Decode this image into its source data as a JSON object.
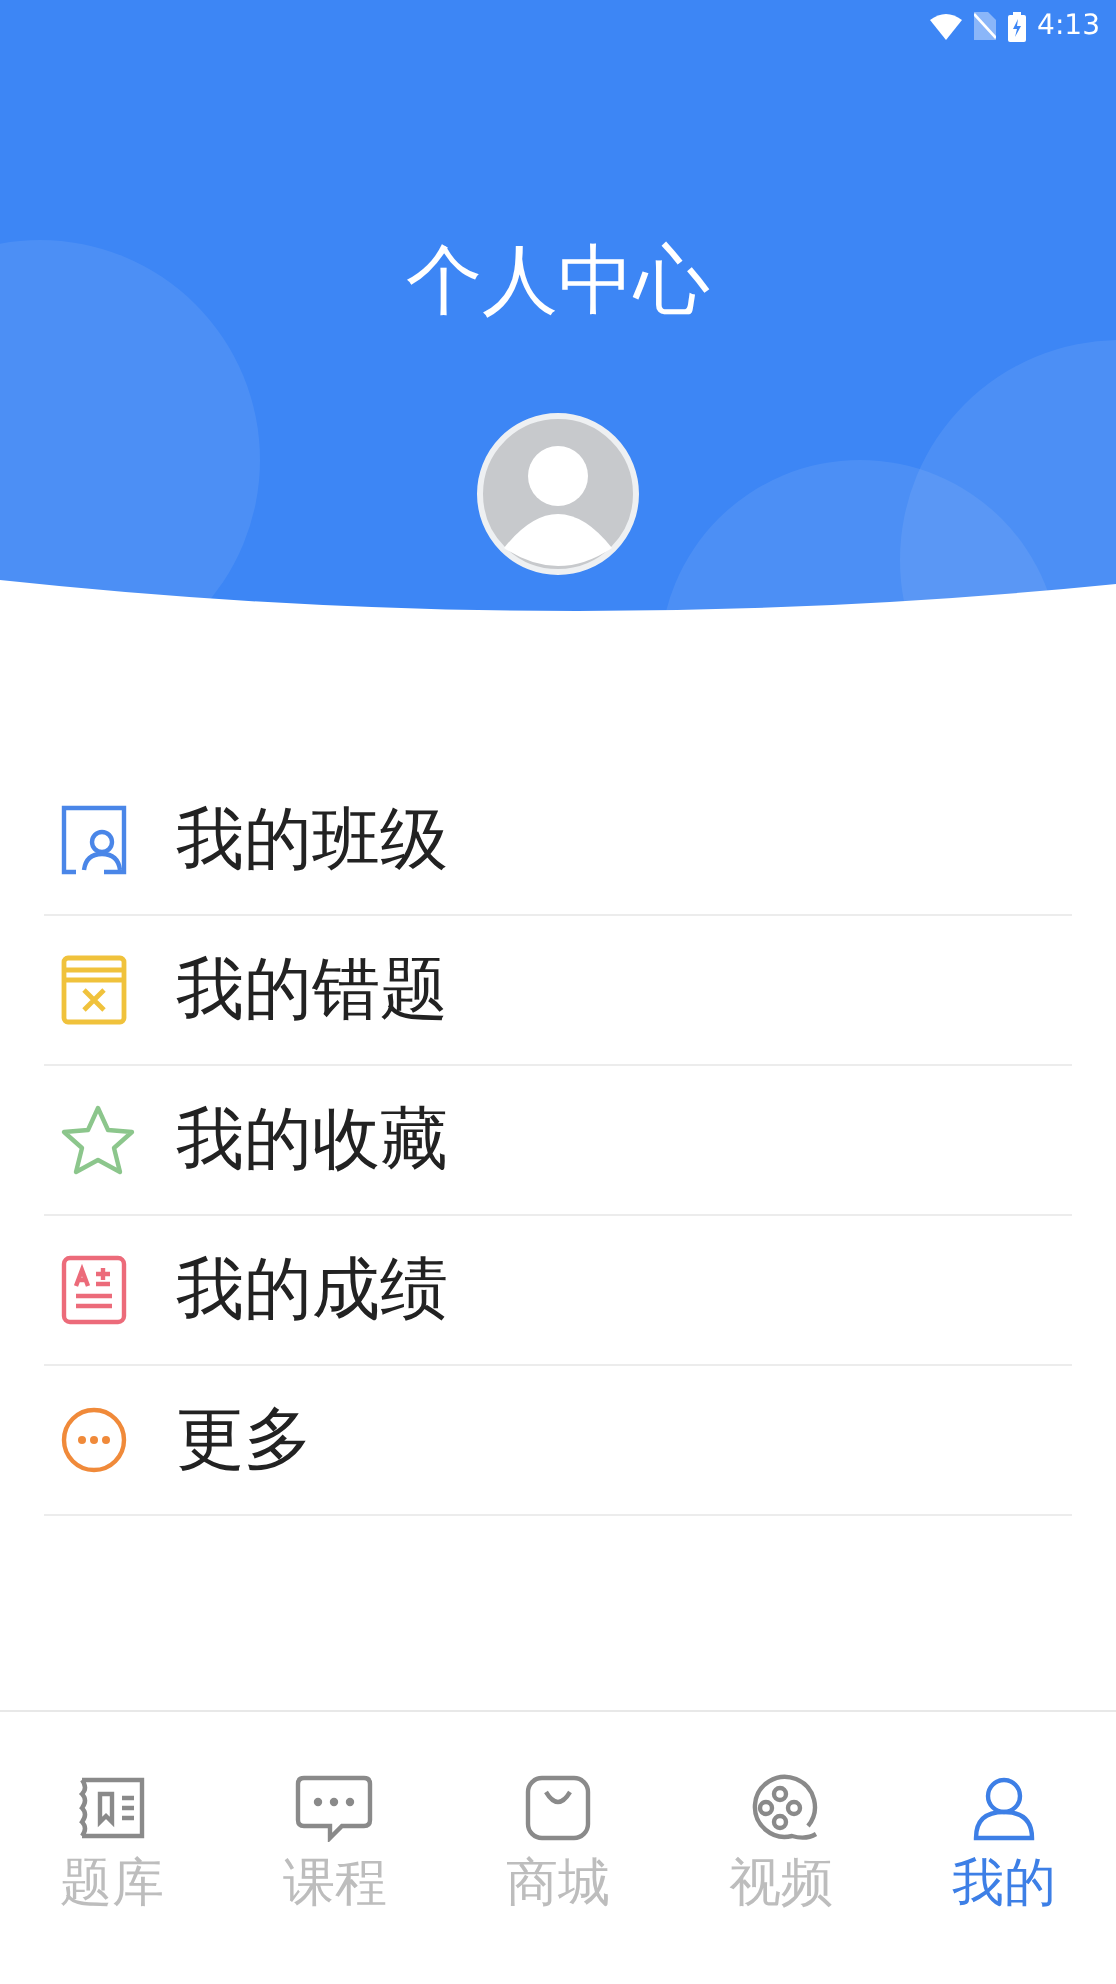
{
  "status_bar": {
    "time": "4:13"
  },
  "header": {
    "title": "个人中心"
  },
  "menu": [
    {
      "kind": "class",
      "label": "我的班级"
    },
    {
      "kind": "mistakes",
      "label": "我的错题"
    },
    {
      "kind": "favorites",
      "label": "我的收藏"
    },
    {
      "kind": "scores",
      "label": "我的成绩"
    },
    {
      "kind": "more",
      "label": "更多"
    }
  ],
  "tab_bar": [
    {
      "kind": "questions",
      "label": "题库",
      "selected": false
    },
    {
      "kind": "courses",
      "label": "课程",
      "selected": false
    },
    {
      "kind": "shop",
      "label": "商城",
      "selected": false
    },
    {
      "kind": "video",
      "label": "视频",
      "selected": false
    },
    {
      "kind": "profile",
      "label": "我的",
      "selected": true
    }
  ]
}
